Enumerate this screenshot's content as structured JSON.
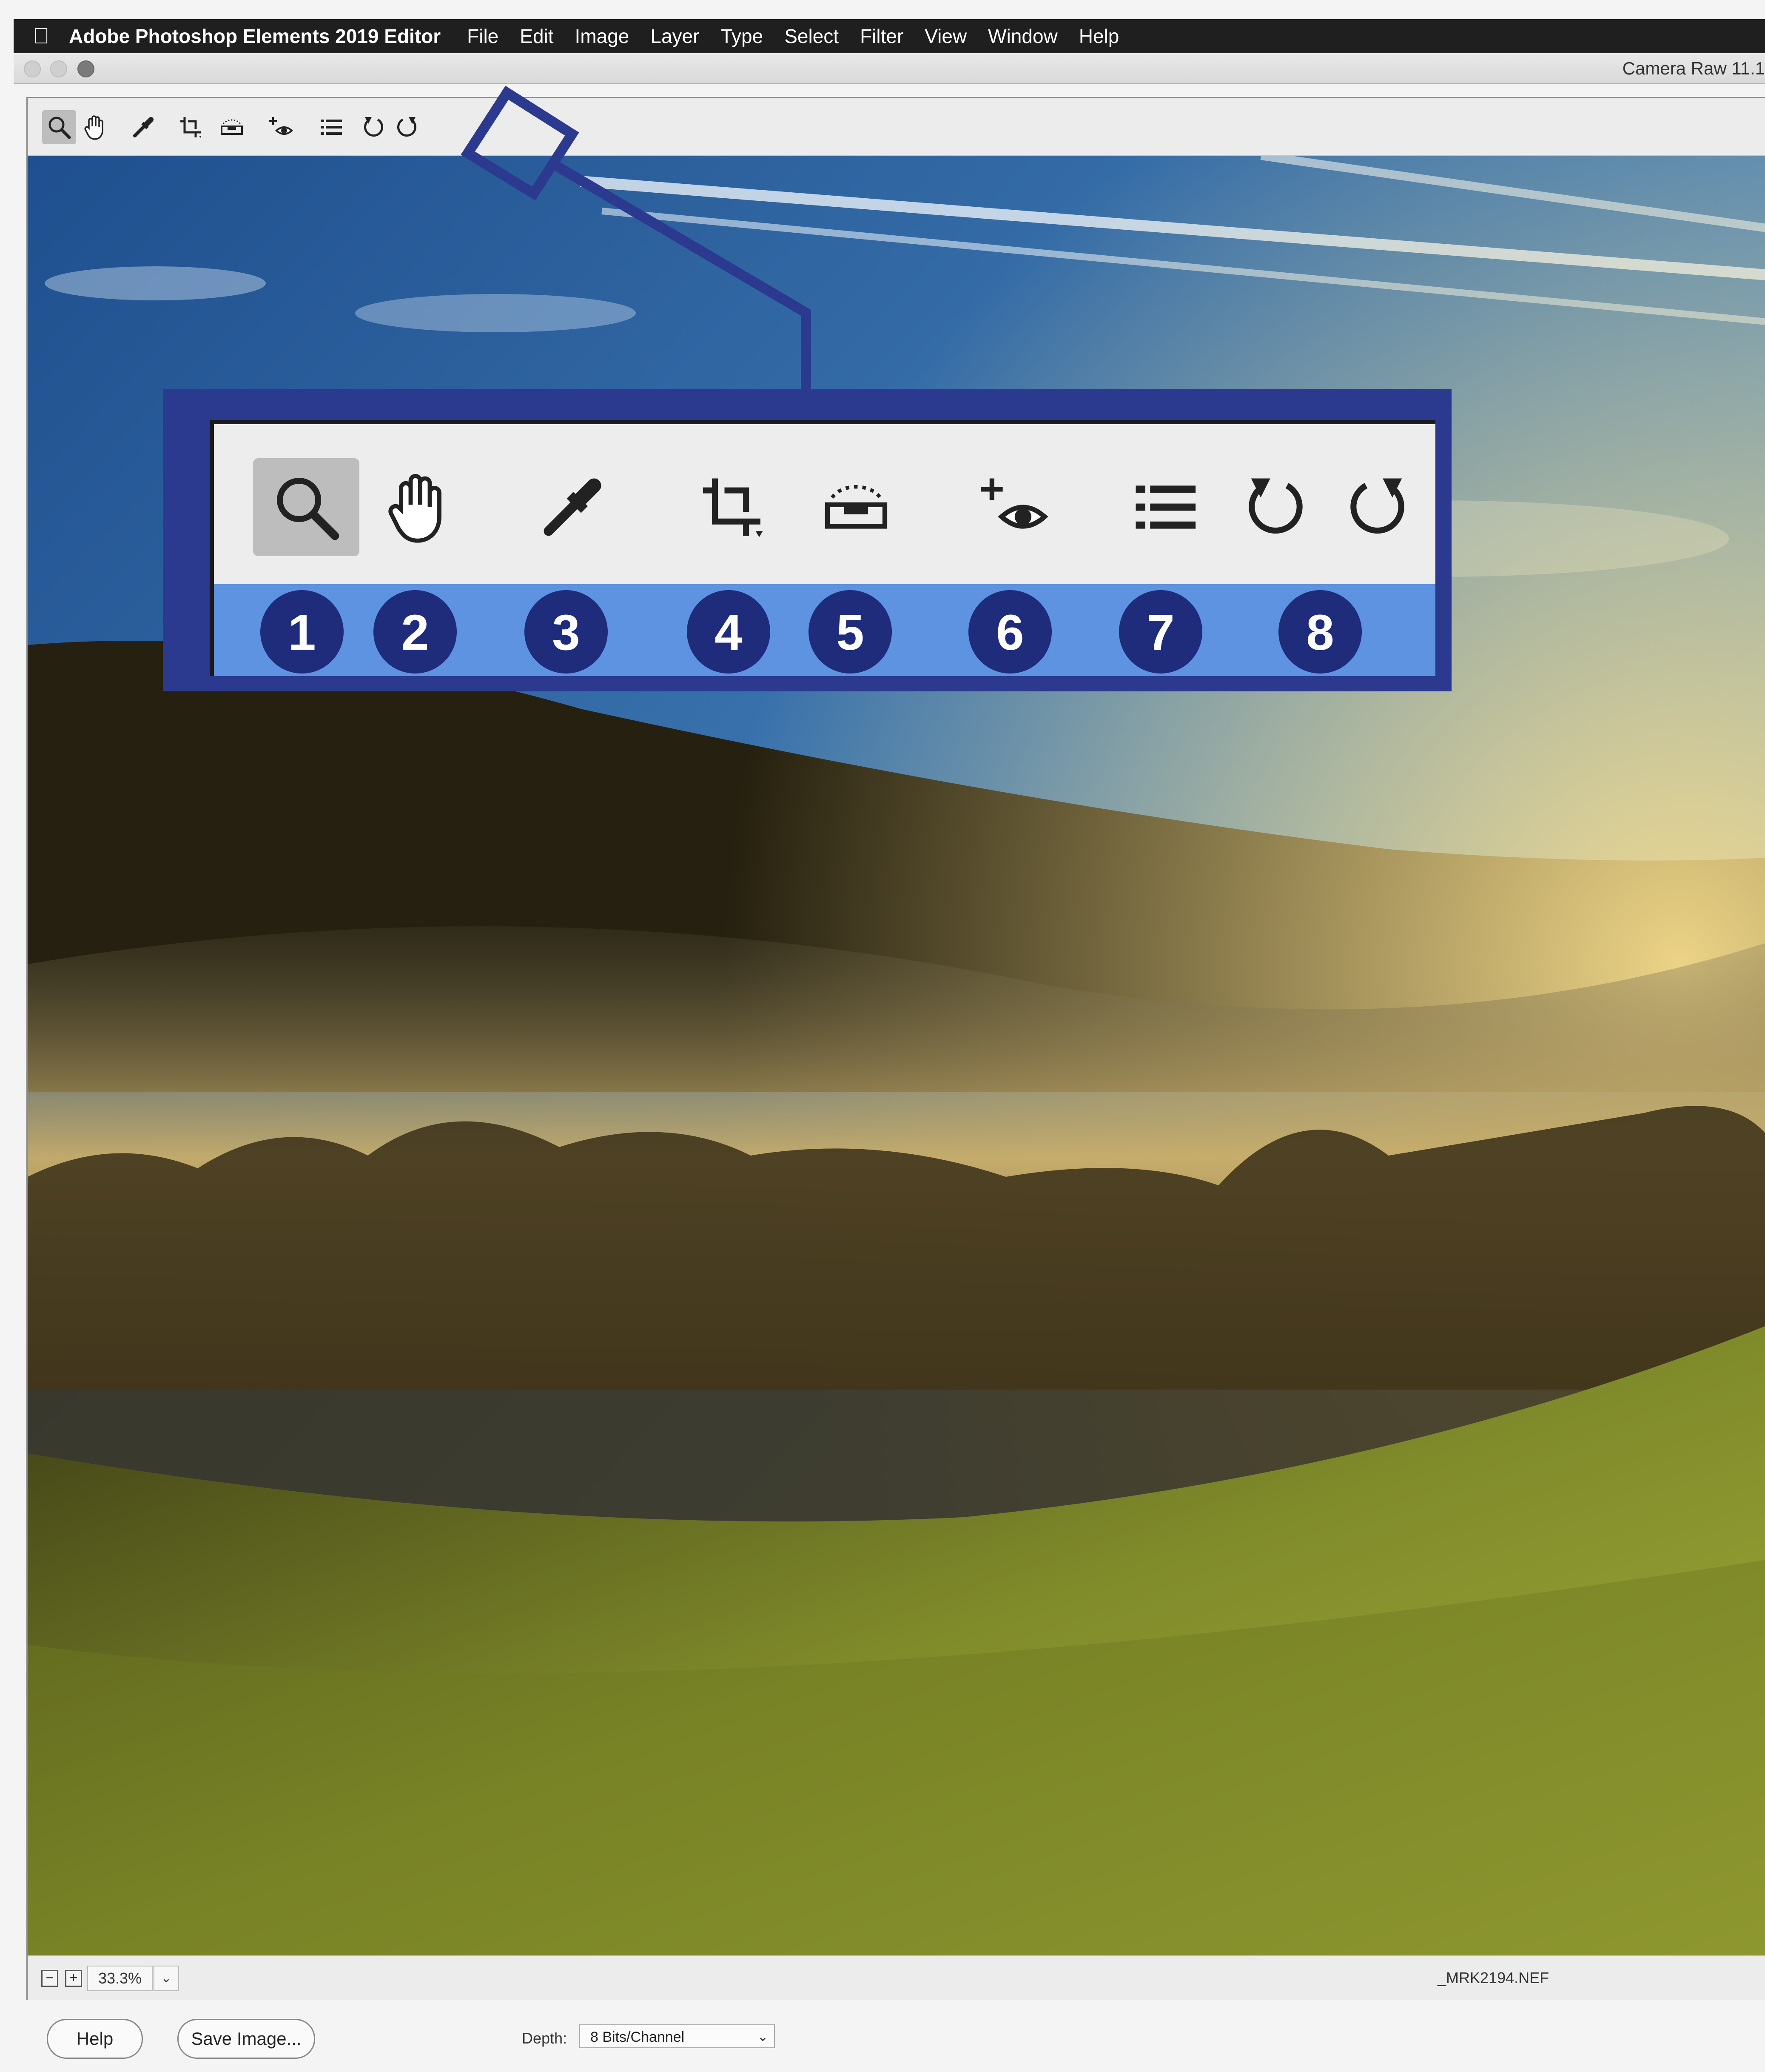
{
  "menubar": {
    "app_name": "Adobe Photoshop Elements 2019 Editor",
    "menus": [
      "File",
      "Edit",
      "Image",
      "Layer",
      "Type",
      "Select",
      "Filter",
      "View",
      "Window",
      "Help"
    ]
  },
  "window": {
    "title": "Camera Raw 11.1"
  },
  "toolbar": {
    "tools": [
      {
        "name": "zoom-tool",
        "icon": "magnifier-icon",
        "selected": true
      },
      {
        "name": "hand-tool",
        "icon": "hand-icon"
      },
      {
        "name": "white-balance-tool",
        "icon": "eyedropper-icon"
      },
      {
        "name": "crop-tool",
        "icon": "crop-icon"
      },
      {
        "name": "straighten-tool",
        "icon": "level-icon"
      },
      {
        "name": "red-eye-removal-tool",
        "icon": "plus-eye-icon"
      },
      {
        "name": "preferences-tool",
        "icon": "list-icon"
      },
      {
        "name": "rotate-left-tool",
        "icon": "rotate-ccw-icon"
      },
      {
        "name": "rotate-right-tool",
        "icon": "rotate-cw-icon"
      }
    ]
  },
  "callout": {
    "numbers": [
      "1",
      "2",
      "3",
      "4",
      "5",
      "6",
      "7",
      "8"
    ],
    "frame_color": "#2b3a8f",
    "band_color": "#5d93e0",
    "badge_color": "#1f2b7b"
  },
  "statusbar": {
    "zoom_out_symbol": "−",
    "zoom_in_symbol": "+",
    "zoom_value": "33.3%",
    "filename": "_MRK2194.NEF"
  },
  "bottombar": {
    "help_label": "Help",
    "save_label": "Save Image...",
    "depth_label": "Depth:",
    "depth_value": "8 Bits/Channel"
  }
}
